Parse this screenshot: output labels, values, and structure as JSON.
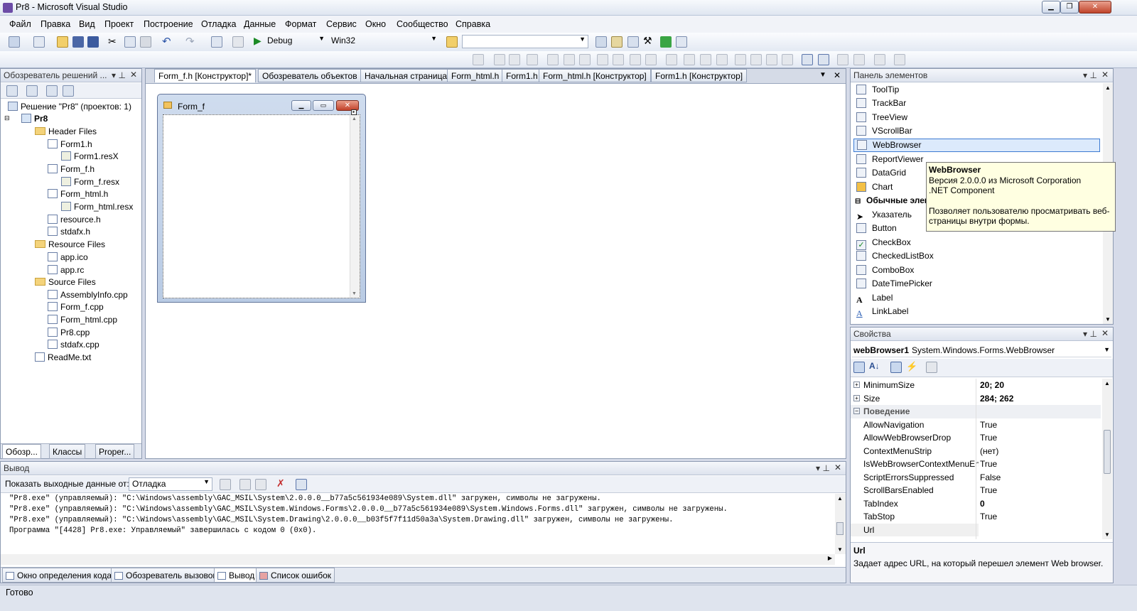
{
  "window": {
    "title": "Pr8 - Microsoft Visual Studio"
  },
  "menu": [
    "Файл",
    "Правка",
    "Вид",
    "Проект",
    "Построение",
    "Отладка",
    "Данные",
    "Формат",
    "Сервис",
    "Окно",
    "Сообщество",
    "Справка"
  ],
  "toolbar": {
    "config": "Debug",
    "platform": "Win32",
    "find": ""
  },
  "solution_explorer": {
    "title": "Обозреватель решений ...",
    "solution": "Решение \"Pr8\"  (проектов: 1)",
    "project": "Pr8",
    "header_files": "Header Files",
    "form1_h": "Form1.h",
    "form1_resx": "Form1.resX",
    "formf_h": "Form_f.h",
    "formf_resx": "Form_f.resx",
    "formhtml_h": "Form_html.h",
    "formhtml_resx": "Form_html.resx",
    "resource_h": "resource.h",
    "stdafx_h": "stdafx.h",
    "resource_files": "Resource Files",
    "app_ico": "app.ico",
    "app_rc": "app.rc",
    "source_files": "Source Files",
    "assemblyinfo": "AssemblyInfo.cpp",
    "formf_cpp": "Form_f.cpp",
    "formhtml_cpp": "Form_html.cpp",
    "pr8_cpp": "Pr8.cpp",
    "stdafx_cpp": "stdafx.cpp",
    "readme": "ReadMe.txt",
    "bottom_tabs": [
      "Обозр...",
      "Классы",
      "Proper..."
    ]
  },
  "doc_tabs": [
    "Form_f.h [Конструктор]*",
    "Обозреватель объектов",
    "Начальная страница",
    "Form_html.h",
    "Form1.h",
    "Form_html.h [Конструктор]",
    "Form1.h [Конструктор]"
  ],
  "designer": {
    "form_title": "Form_f"
  },
  "toolbox": {
    "title": "Панель элементов",
    "items": [
      "ToolTip",
      "TrackBar",
      "TreeView",
      "VScrollBar",
      "WebBrowser",
      "ReportViewer",
      "DataGrid",
      "Chart"
    ],
    "group": "Обычные элем",
    "items2": [
      "Указатель",
      "Button",
      "CheckBox",
      "CheckedListBox",
      "ComboBox",
      "DateTimePicker",
      "Label",
      "LinkLabel"
    ],
    "selected": "WebBrowser"
  },
  "tooltip": {
    "title": "WebBrowser",
    "line1": "Версия 2.0.0.0 из Microsoft Corporation",
    ".line2": "",
    "line2": ".NET Component",
    "desc1": "Позволяет пользователю просматривать веб-",
    "desc2": "страницы внутри формы."
  },
  "properties": {
    "title": "Свойства",
    "object": "webBrowser1",
    "object_type": "System.Windows.Forms.WebBrowser",
    "rows": [
      {
        "name": "MinimumSize",
        "value": "20; 20",
        "bold": true,
        "exp": "+"
      },
      {
        "name": "Size",
        "value": "284; 262",
        "bold": true,
        "exp": "+"
      },
      {
        "name": "Поведение",
        "value": "",
        "cat": true,
        "exp": "−"
      },
      {
        "name": "AllowNavigation",
        "value": "True"
      },
      {
        "name": "AllowWebBrowserDrop",
        "value": "True"
      },
      {
        "name": "ContextMenuStrip",
        "value": "(нет)"
      },
      {
        "name": "IsWebBrowserContextMenuEna",
        "value": "True"
      },
      {
        "name": "ScriptErrorsSuppressed",
        "value": "False"
      },
      {
        "name": "ScrollBarsEnabled",
        "value": "True"
      },
      {
        "name": "TabIndex",
        "value": "0",
        "bold": true
      },
      {
        "name": "TabStop",
        "value": "True"
      },
      {
        "name": "Url",
        "value": ""
      }
    ],
    "desc_title": "Url",
    "desc_text": "Задает адрес URL, на который перешел элемент Web browser."
  },
  "output": {
    "title": "Вывод",
    "show_label": "Показать выходные данные от:",
    "source": "Отладка",
    "lines": [
      "\"Pr8.exe\" (управляемый): \"C:\\Windows\\assembly\\GAC_MSIL\\System\\2.0.0.0__b77a5c561934e089\\System.dll\" загружен, символы не загружены.",
      "\"Pr8.exe\" (управляемый): \"C:\\Windows\\assembly\\GAC_MSIL\\System.Windows.Forms\\2.0.0.0__b77a5c561934e089\\System.Windows.Forms.dll\" загружен, символы не загружены.",
      "\"Pr8.exe\" (управляемый): \"C:\\Windows\\assembly\\GAC_MSIL\\System.Drawing\\2.0.0.0__b03f5f7f11d50a3a\\System.Drawing.dll\" загружен, символы не загружены.",
      "Программа \"[4428] Pr8.exe: Управляемый\" завершилась с кодом 0 (0x0)."
    ]
  },
  "bottom_tabs": [
    "Окно определения кода",
    "Обозреватель вызовов",
    "Вывод",
    "Список ошибок"
  ],
  "status": "Готово"
}
